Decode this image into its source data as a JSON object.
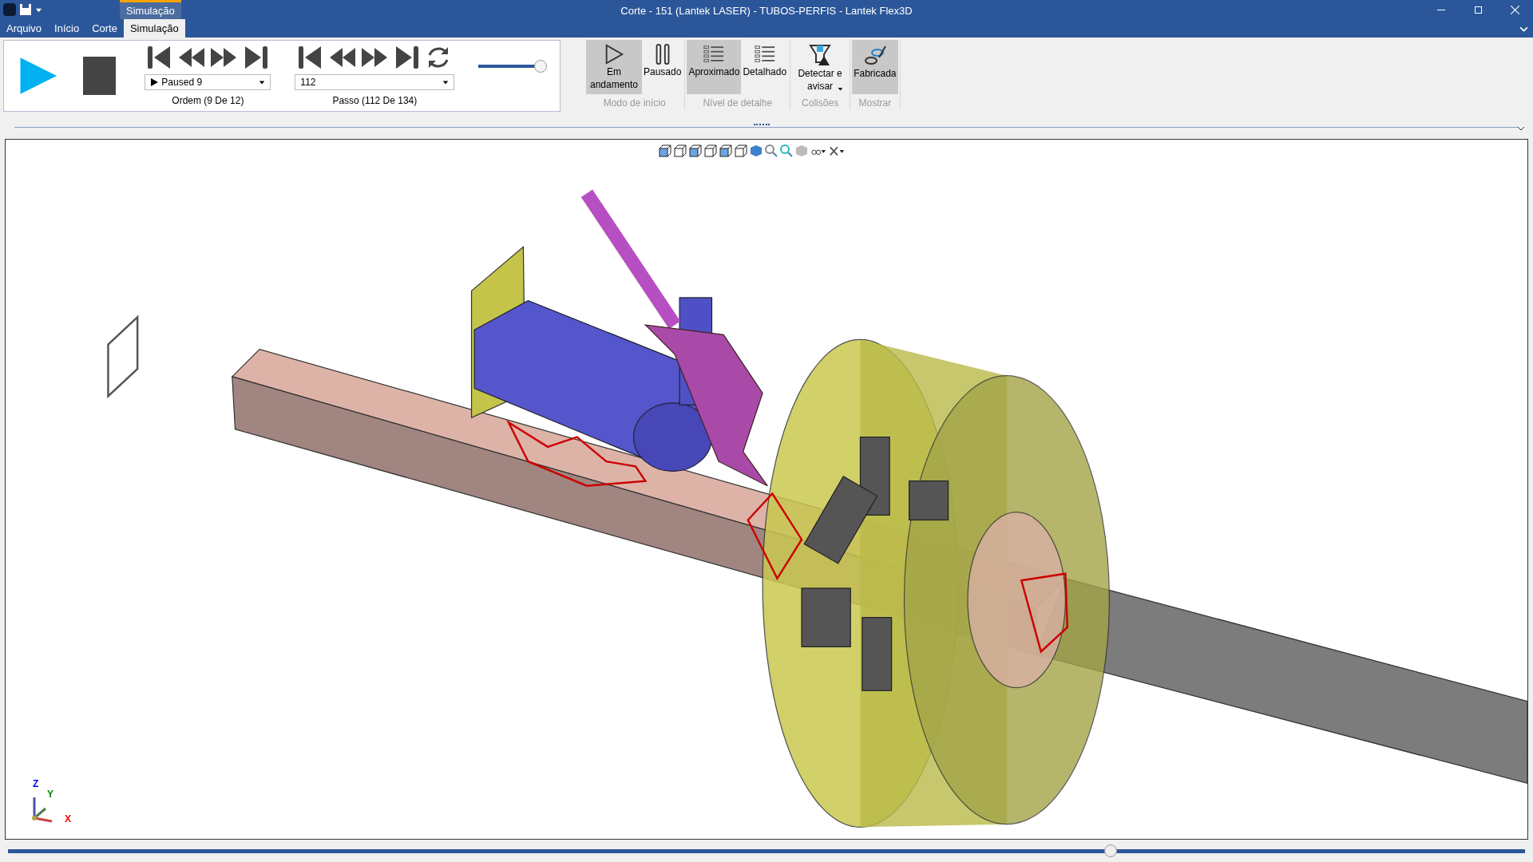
{
  "window": {
    "title": "Corte - 151 (Lantek LASER) - TUBOS-PERFIS - Lantek Flex3D"
  },
  "context_tab": {
    "label": "Simulação"
  },
  "tabs": [
    {
      "label": "Arquivo",
      "selected": false
    },
    {
      "label": "Início",
      "selected": false
    },
    {
      "label": "Corte",
      "selected": false
    },
    {
      "label": "Simulação",
      "selected": true
    }
  ],
  "player": {
    "order_select": {
      "value": "Paused 9"
    },
    "order_caption": "Ordem (9 De 12)",
    "step_select": {
      "value": "112"
    },
    "step_caption": "Passo (112 De 134)",
    "speed": {
      "level": 0.93
    }
  },
  "ribbon_groups": [
    {
      "label": "Modo de início",
      "buttons": [
        {
          "kind": "play",
          "label": "Em andamento",
          "selected": true
        },
        {
          "kind": "pause",
          "label": "Pausado",
          "selected": false
        }
      ]
    },
    {
      "label": "Nível de detalhe",
      "buttons": [
        {
          "kind": "list",
          "label": "Aproximado",
          "selected": true
        },
        {
          "kind": "list",
          "label": "Detalhado",
          "selected": false
        }
      ]
    },
    {
      "label": "Colisões",
      "buttons": [
        {
          "kind": "detect",
          "label": "Detectar e avisar",
          "selected": false,
          "dropdown": true
        }
      ]
    },
    {
      "label": "Mostrar",
      "buttons": [
        {
          "kind": "fabricated",
          "label": "Fabricada",
          "selected": true
        }
      ]
    }
  ],
  "viewport": {
    "axes": {
      "z": "Z",
      "y": "Y",
      "x": "X"
    }
  },
  "timeline": {
    "level": 0.727
  }
}
